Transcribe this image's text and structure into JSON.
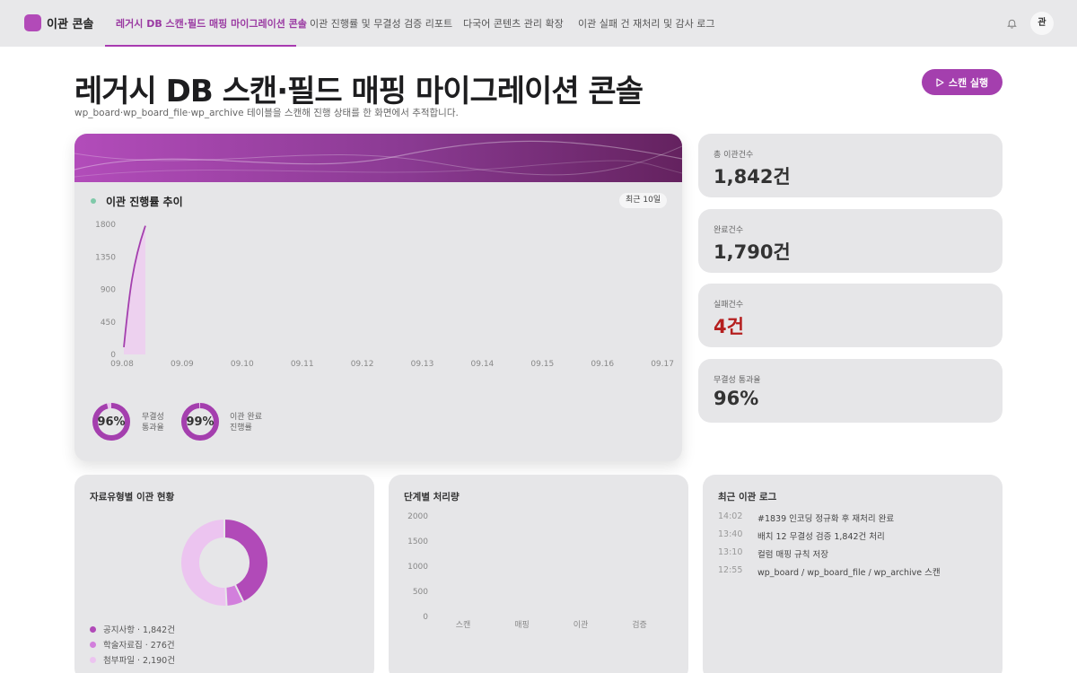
{
  "app": {
    "name": "이관 콘솔"
  },
  "nav": {
    "tabs": [
      {
        "label": "레거시 DB 스캔·필드 매핑 마이그레이션 콘솔",
        "active": true
      },
      {
        "label": "이관 진행률 및 무결성 검증 리포트",
        "active": false
      },
      {
        "label": "다국어 콘텐츠 관리 확장",
        "active": false
      },
      {
        "label": "이관 실패 건 재처리 및 감사 로그",
        "active": false
      }
    ],
    "avatar": "관",
    "bell_icon": "bell-icon"
  },
  "page": {
    "title": "레거시 DB 스캔·필드 매핑 마이그레이션 콘솔",
    "subtitle": "wp_board·wp_board_file·wp_archive 테이블을 스캔해 진행 상태를 한 화면에서 추적합니다.",
    "scan_button": "스캔 실행",
    "scan_icon": "play-icon"
  },
  "colors": {
    "accent": "#a43fae",
    "accent_light": "#d27fdc",
    "accent_pale": "#ecc4f0",
    "danger": "#b51f1f",
    "dot": "#7fc9a9"
  },
  "progress_card": {
    "title": "이관 진행률 추이",
    "range": "최근 10일",
    "gauges": [
      {
        "value": 0.96,
        "text": "96%",
        "label_line1": "무결성",
        "label_line2": "통과율"
      },
      {
        "value": 0.99,
        "text": "99%",
        "label_line1": "이관 완료",
        "label_line2": "진행률"
      }
    ]
  },
  "stats": [
    {
      "label": "총 이관건수",
      "value": "1,842건",
      "color": "#333333"
    },
    {
      "label": "완료건수",
      "value": "1,790건",
      "color": "#333333"
    },
    {
      "label": "실패건수",
      "value": "4건",
      "color": "#b51f1f"
    },
    {
      "label": "무결성 통과율",
      "value": "96%",
      "color": "#333333"
    }
  ],
  "type_card": {
    "title": "자료유형별 이관 현황",
    "legend": [
      {
        "label": "공지사항 · 1,842건",
        "color": "#b14ab8"
      },
      {
        "label": "학술자료집 · 276건",
        "color": "#d27fdc"
      },
      {
        "label": "첨부파일 · 2,190건",
        "color": "#ecc4f0"
      }
    ]
  },
  "stage_card": {
    "title": "단계별 처리량"
  },
  "log_card": {
    "title": "최근 이관 로그",
    "entries": [
      {
        "time": "14:02",
        "message": "#1839 인코딩 정규화 후 재처리 완료"
      },
      {
        "time": "13:40",
        "message": "배치 12 무결성 검증 1,842건 처리"
      },
      {
        "time": "13:10",
        "message": "컬럼 매핑 규칙 저장"
      },
      {
        "time": "12:55",
        "message": "wp_board / wp_board_file / wp_archive 스캔"
      }
    ]
  },
  "chart_data": [
    {
      "type": "area",
      "x": [
        "09.08",
        "09.09",
        "09.10",
        "09.11",
        "09.12",
        "09.13",
        "09.14",
        "09.15",
        "09.16",
        "09.17"
      ],
      "series": [
        {
          "values": [
            100,
            1780,
            null,
            null,
            null,
            null,
            null,
            null,
            null,
            null
          ]
        }
      ],
      "y_ticks": [
        0,
        450,
        900,
        1350,
        1800
      ],
      "ylim": [
        0,
        1800
      ],
      "grid": false
    },
    {
      "type": "pie",
      "title": "자료유형별 이관 현황",
      "labels": [
        "공지사항",
        "학술자료집",
        "첨부파일"
      ],
      "values": [
        1842,
        276,
        2190
      ]
    },
    {
      "type": "bar",
      "title": "단계별 처리량",
      "categories": [
        "스캔",
        "매핑",
        "이관",
        "검증"
      ],
      "values": [
        0,
        0,
        0,
        0
      ],
      "y_ticks": [
        0,
        500,
        1000,
        1500,
        2000
      ],
      "ylim": [
        0,
        2000
      ],
      "grid": false
    }
  ]
}
